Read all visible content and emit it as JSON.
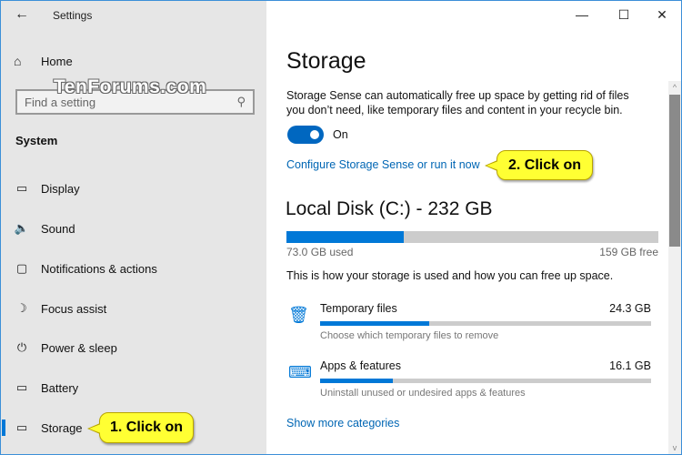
{
  "app": {
    "title": "Settings",
    "back_icon": "←"
  },
  "watermark": "TenForums.com",
  "sidebar": {
    "home": {
      "label": "Home",
      "icon": "⌂"
    },
    "search": {
      "placeholder": "Find a setting",
      "value": "",
      "icon": "⚲"
    },
    "section_title": "System",
    "items": [
      {
        "label": "Display",
        "icon": "▭",
        "icon_name": "display-icon"
      },
      {
        "label": "Sound",
        "icon": "🔈",
        "icon_name": "sound-icon"
      },
      {
        "label": "Notifications & actions",
        "icon": "▢",
        "icon_name": "notifications-icon"
      },
      {
        "label": "Focus assist",
        "icon": "☽",
        "icon_name": "focus-assist-icon"
      },
      {
        "label": "Power & sleep",
        "icon": "⏻",
        "icon_name": "power-icon"
      },
      {
        "label": "Battery",
        "icon": "▭",
        "icon_name": "battery-icon"
      },
      {
        "label": "Storage",
        "icon": "▭",
        "icon_name": "storage-icon",
        "active": true
      }
    ]
  },
  "window_controls": {
    "minimize": "—",
    "maximize": "☐",
    "close": "✕"
  },
  "main": {
    "title": "Storage",
    "description": "Storage Sense can automatically free up space by getting rid of files you don’t need, like temporary files and content in your recycle bin.",
    "toggle": {
      "state": "On",
      "on": true
    },
    "configure_link": "Configure Storage Sense or run it now",
    "disk": {
      "title": "Local Disk (C:) - 232 GB",
      "used_label": "73.0 GB used",
      "free_label": "159 GB free",
      "used_fraction": 0.315
    },
    "intro": "This is how your storage is used and how you can free up space.",
    "categories": [
      {
        "name": "Temporary files",
        "size": "24.3 GB",
        "sub": "Choose which temporary files to remove",
        "fraction": 0.33,
        "icon": "🗑"
      },
      {
        "name": "Apps & features",
        "size": "16.1 GB",
        "sub": "Uninstall unused or undesired apps & features",
        "fraction": 0.22,
        "icon": "⌨"
      }
    ],
    "more_link": "Show more categories"
  },
  "scrollbar": {
    "up": "^",
    "down": "v"
  },
  "callouts": {
    "step1": "1. Click on",
    "step2": "2. Click on"
  },
  "colors": {
    "accent": "#0078d7",
    "link": "#0066b4",
    "callout": "#ffff33",
    "sidebar_bg": "#e6e6e6"
  }
}
